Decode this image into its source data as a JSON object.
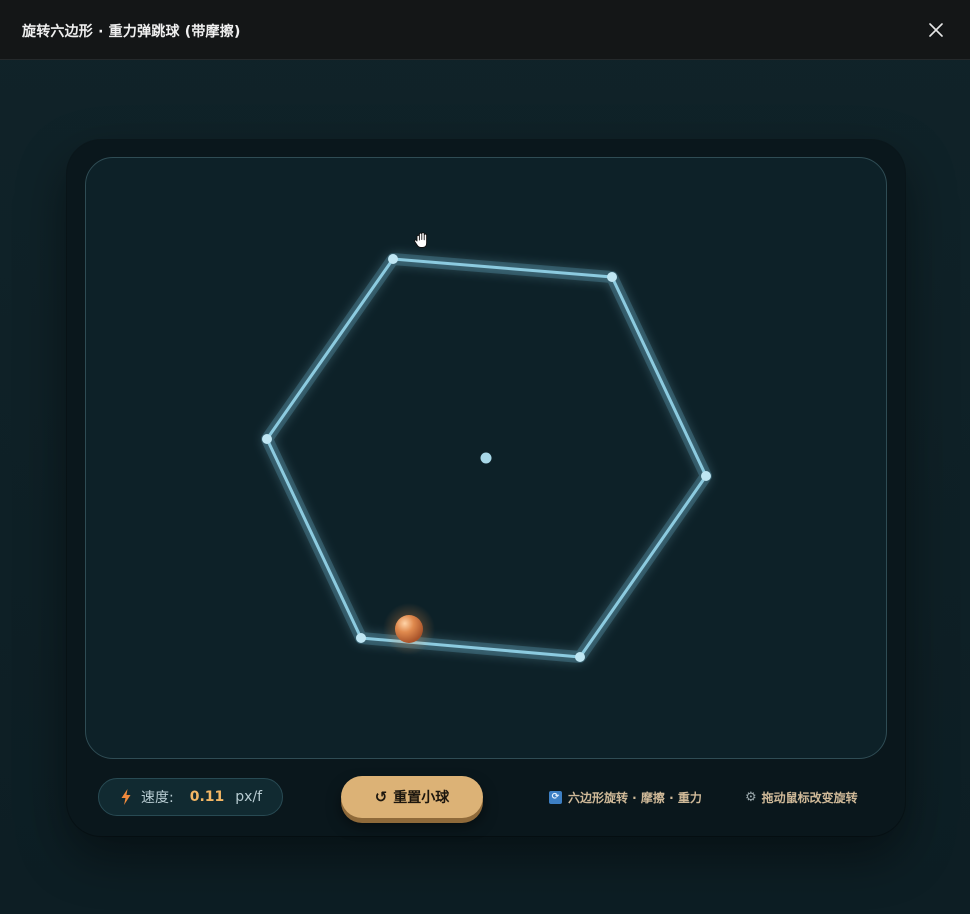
{
  "window": {
    "title": "旋转六边形 · 重力弹跳球 (带摩擦)",
    "close_icon": "close-icon"
  },
  "stage": {
    "cursor_icon": "grab-hand-icon",
    "hexagon_color": "#8ccbe0",
    "ball_color": "#d9824a"
  },
  "controls": {
    "speed": {
      "icon": "lightning-icon",
      "label": "速度:",
      "value": "0.11",
      "unit": "px/f"
    },
    "reset_button": {
      "icon": "reset-icon",
      "label": "重置小球"
    },
    "hints": {
      "features": {
        "icon": "rotate-icon",
        "text": "六边形旋转 · 摩擦 · 重力"
      },
      "drag": {
        "icon": "gear-icon",
        "text": "拖动鼠标改变旋转"
      }
    }
  },
  "colors": {
    "accent": "#dcb276",
    "speed_value": "#f4b765",
    "hexagon": "#8ccbe0",
    "background": "#0d2128"
  }
}
